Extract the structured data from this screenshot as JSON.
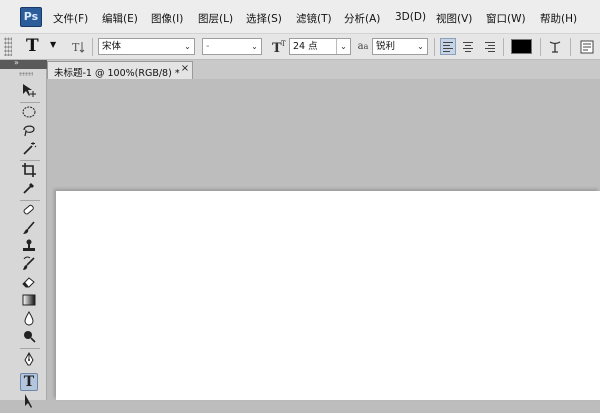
{
  "app": {
    "logo": "Ps"
  },
  "menu": {
    "items": [
      "文件(F)",
      "编辑(E)",
      "图像(I)",
      "图层(L)",
      "选择(S)",
      "滤镜(T)",
      "分析(A)",
      "3D(D)",
      "视图(V)",
      "窗口(W)",
      "帮助(H)"
    ]
  },
  "options": {
    "tool_glyph": "T",
    "font_family": "宋体",
    "font_style": "-",
    "font_size": "24 点",
    "aa_label": "a",
    "anti_alias": "锐利",
    "color_swatch": "#000000"
  },
  "document": {
    "tab_title": "未标题-1 @ 100%(RGB/8) *",
    "close_glyph": "×"
  },
  "tools": {
    "active": "type-tool",
    "items": [
      "move-tool",
      "marquee-tool",
      "lasso-tool",
      "magic-wand-tool",
      "crop-tool",
      "eyedropper-tool",
      "healing-brush-tool",
      "brush-tool",
      "clone-stamp-tool",
      "history-brush-tool",
      "eraser-tool",
      "gradient-tool",
      "blur-tool",
      "dodge-tool",
      "pen-tool",
      "type-tool"
    ]
  },
  "colors": {
    "accent": "#2c5c99",
    "workspace": "#bdbdbd",
    "canvas": "#ffffff",
    "toolbar": "#d7d7d7"
  }
}
